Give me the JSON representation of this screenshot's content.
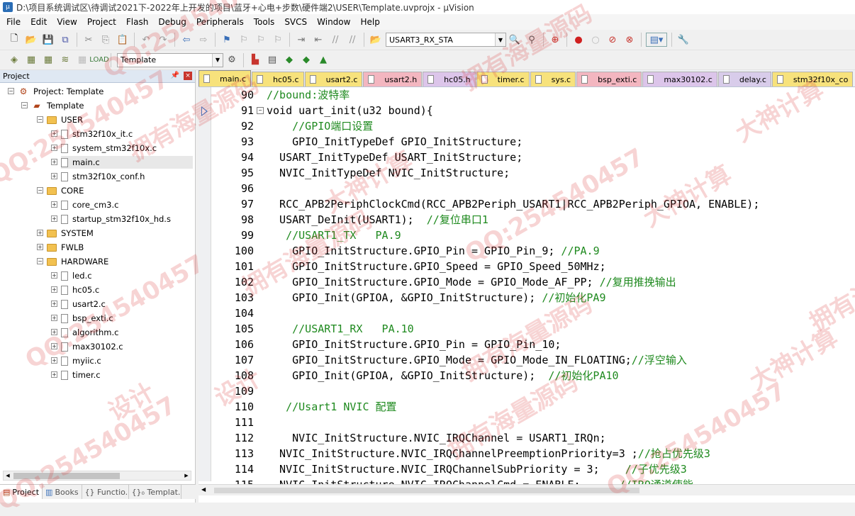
{
  "window": {
    "title": "D:\\项目系统调试区\\待调试2021下-2022年上开发的项目\\蓝牙+心电+步数\\硬件端2\\USER\\Template.uvprojx - µVision"
  },
  "menu": [
    "File",
    "Edit",
    "View",
    "Project",
    "Flash",
    "Debug",
    "Peripherals",
    "Tools",
    "SVCS",
    "Window",
    "Help"
  ],
  "toolbar1": {
    "find_combo_value": "USART3_RX_STA"
  },
  "toolbar2": {
    "target_combo_value": "Template"
  },
  "project_panel": {
    "title": "Project",
    "root": "Project: Template",
    "target": "Template",
    "groups": [
      {
        "name": "USER",
        "files": [
          "stm32f10x_it.c",
          "system_stm32f10x.c",
          "main.c",
          "stm32f10x_conf.h"
        ]
      },
      {
        "name": "CORE",
        "files": [
          "core_cm3.c",
          "startup_stm32f10x_hd.s"
        ]
      },
      {
        "name": "SYSTEM",
        "files": []
      },
      {
        "name": "FWLB",
        "files": []
      },
      {
        "name": "HARDWARE",
        "files": [
          "led.c",
          "hc05.c",
          "usart2.c",
          "bsp_exti.c",
          "algorithm.c",
          "max30102.c",
          "myiic.c",
          "timer.c"
        ]
      }
    ],
    "bottom_tabs": [
      "Project",
      "Books",
      "{} Functio...",
      "{}₀ Templat..."
    ]
  },
  "file_tabs": [
    {
      "label": "main.c",
      "color": "#f7e27c"
    },
    {
      "label": "hc05.c",
      "color": "#f7e27c"
    },
    {
      "label": "usart2.c",
      "color": "#f7e27c"
    },
    {
      "label": "usart2.h",
      "color": "#f3b6c0"
    },
    {
      "label": "hc05.h",
      "color": "#dcc5ea"
    },
    {
      "label": "timer.c",
      "color": "#f7e27c"
    },
    {
      "label": "sys.c",
      "color": "#f7e27c"
    },
    {
      "label": "bsp_exti.c",
      "color": "#f3b6c0"
    },
    {
      "label": "max30102.c",
      "color": "#dcc5ea"
    },
    {
      "label": "delay.c",
      "color": "#d8ccea"
    },
    {
      "label": "stm32f10x_co",
      "color": "#f7e27c"
    }
  ],
  "code_lines": [
    {
      "n": "90",
      "code": "",
      "comment": "//bound:波特率"
    },
    {
      "n": "91",
      "code": "void uart_init(u32 bound){",
      "comment": ""
    },
    {
      "n": "92",
      "code": "    ",
      "comment": "//GPIO端口设置"
    },
    {
      "n": "93",
      "code": "    GPIO_InitTypeDef GPIO_InitStructure;",
      "comment": ""
    },
    {
      "n": "94",
      "code": "  USART_InitTypeDef USART_InitStructure;",
      "comment": ""
    },
    {
      "n": "95",
      "code": "  NVIC_InitTypeDef NVIC_InitStructure;",
      "comment": ""
    },
    {
      "n": "96",
      "code": "",
      "comment": ""
    },
    {
      "n": "97",
      "code": "  RCC_APB2PeriphClockCmd(RCC_APB2Periph_USART1|RCC_APB2Periph_GPIOA, ENABLE);",
      "comment": ""
    },
    {
      "n": "98",
      "code": "  USART_DeInit(USART1);  ",
      "comment": "//复位串口1"
    },
    {
      "n": "99",
      "code": "   ",
      "comment": "//USART1_TX   PA.9"
    },
    {
      "n": "100",
      "code": "    GPIO_InitStructure.GPIO_Pin = GPIO_Pin_9; ",
      "comment": "//PA.9"
    },
    {
      "n": "101",
      "code": "    GPIO_InitStructure.GPIO_Speed = GPIO_Speed_50MHz;",
      "comment": ""
    },
    {
      "n": "102",
      "code": "    GPIO_InitStructure.GPIO_Mode = GPIO_Mode_AF_PP; ",
      "comment": "//复用推挽输出"
    },
    {
      "n": "103",
      "code": "    GPIO_Init(GPIOA, &GPIO_InitStructure); ",
      "comment": "//初始化PA9"
    },
    {
      "n": "104",
      "code": "",
      "comment": ""
    },
    {
      "n": "105",
      "code": "    ",
      "comment": "//USART1_RX   PA.10"
    },
    {
      "n": "106",
      "code": "    GPIO_InitStructure.GPIO_Pin = GPIO_Pin_10;",
      "comment": ""
    },
    {
      "n": "107",
      "code": "    GPIO_InitStructure.GPIO_Mode = GPIO_Mode_IN_FLOATING;",
      "comment": "//浮空输入"
    },
    {
      "n": "108",
      "code": "    GPIO_Init(GPIOA, &GPIO_InitStructure);  ",
      "comment": "//初始化PA10"
    },
    {
      "n": "109",
      "code": "",
      "comment": ""
    },
    {
      "n": "110",
      "code": "   ",
      "comment": "//Usart1 NVIC 配置"
    },
    {
      "n": "111",
      "code": "",
      "comment": ""
    },
    {
      "n": "112",
      "code": "    NVIC_InitStructure.NVIC_IRQChannel = USART1_IRQn;",
      "comment": ""
    },
    {
      "n": "113",
      "code": "  NVIC_InitStructure.NVIC_IRQChannelPreemptionPriority=3 ;",
      "comment": "//抢占优先级3"
    },
    {
      "n": "114",
      "code": "  NVIC_InitStructure.NVIC_IRQChannelSubPriority = 3;    ",
      "comment": "//子优先级3"
    },
    {
      "n": "115",
      "code": "  NVIC_InitStructure.NVIC_IRQChannelCmd = ENABLE;      ",
      "comment": "//IRQ通道使能"
    }
  ],
  "watermarks": [
    "大神计算",
    "QQ:254540457",
    "拥有海量源码",
    "设计"
  ]
}
